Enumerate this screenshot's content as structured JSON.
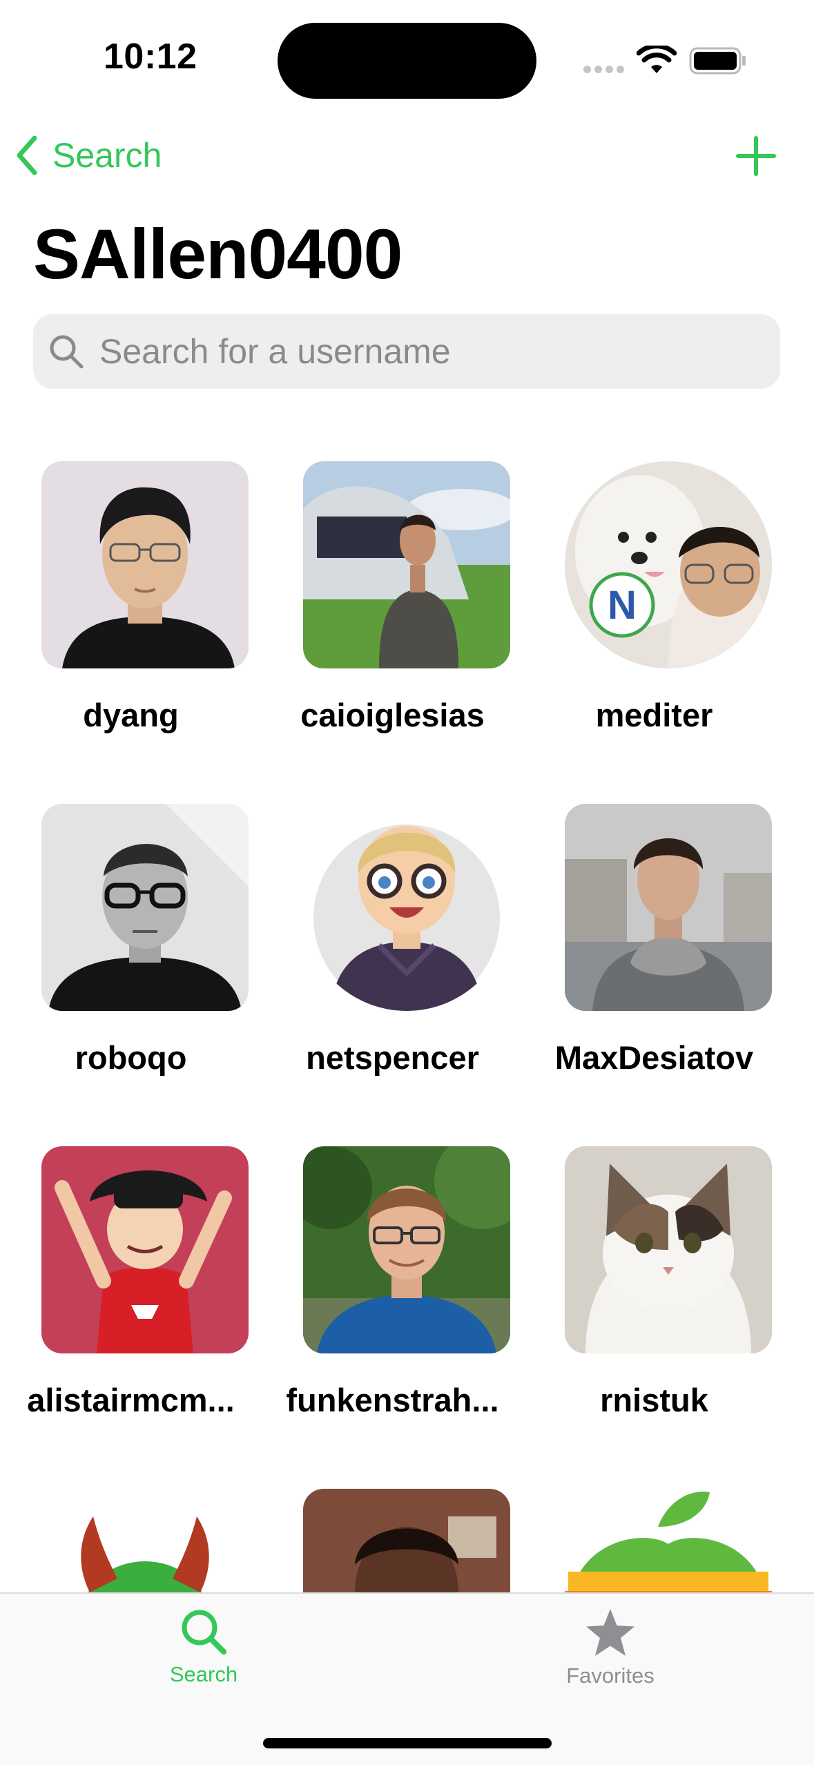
{
  "status_bar": {
    "time": "10:12"
  },
  "nav": {
    "back_label": "Search",
    "title": "SAllen0400"
  },
  "search": {
    "placeholder": "Search for a username",
    "value": ""
  },
  "users": [
    {
      "username": "dyang"
    },
    {
      "username": "caioiglesias"
    },
    {
      "username": "mediter"
    },
    {
      "username": "roboqo"
    },
    {
      "username": "netspencer"
    },
    {
      "username": "MaxDesiatov"
    },
    {
      "username": "alistairmcm..."
    },
    {
      "username": "funkenstrah..."
    },
    {
      "username": "rnistuk"
    }
  ],
  "tab_bar": {
    "tabs": [
      {
        "label": "Search",
        "icon": "search-icon",
        "selected": true
      },
      {
        "label": "Favorites",
        "icon": "star-icon",
        "selected": false
      }
    ]
  },
  "colors": {
    "accent": "#34c759",
    "inactive_tab": "#8e8e93",
    "search_field_bg": "#eeeeef"
  }
}
